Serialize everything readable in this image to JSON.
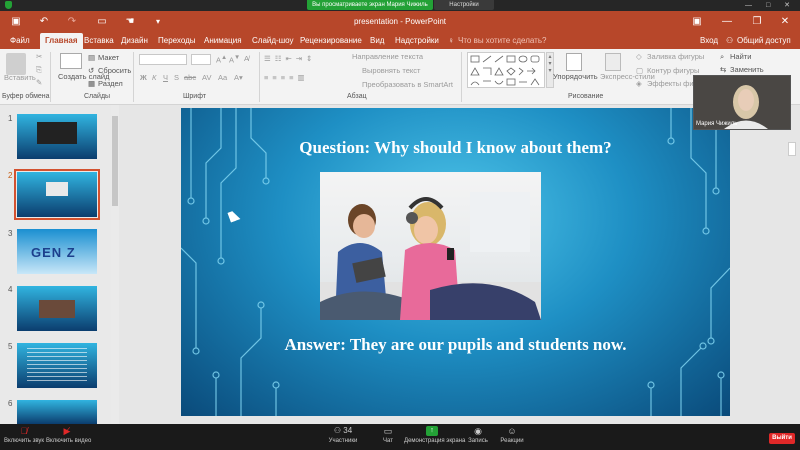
{
  "zoom": {
    "share_banner": "Вы просматриваете экран Мария Чижиль",
    "view_options": "Настройки просмотра ▾",
    "window_controls": "— □ ✕",
    "participant_name": "Мария Чижиль",
    "participant_count": "34",
    "bottom": {
      "mute_label": "Включить звук",
      "video_label": "Включить видео",
      "participants_label": "Участники",
      "chat_label": "Чат",
      "share_label": "Демонстрация экрана",
      "record_label": "Запись",
      "reactions_label": "Реакции",
      "leave_label": "Выйти"
    }
  },
  "ppt": {
    "title": "presentation - PowerPoint",
    "tabs": [
      "Файл",
      "Главная",
      "Вставка",
      "Дизайн",
      "Переходы",
      "Анимация",
      "Слайд-шоу",
      "Рецензирование",
      "Вид",
      "Надстройки"
    ],
    "tell_me": "Что вы хотите сделать?",
    "sign_in": "Вход",
    "share": "Общий доступ",
    "ribbon": {
      "paste": "Вставить",
      "clipboard_group": "Буфер обмена",
      "new_slide": "Создать слайд",
      "layout": "Макет",
      "reset": "Сбросить",
      "section": "Раздел",
      "slides_group": "Слайды",
      "font_group": "Шрифт",
      "text_direction": "Направление текста",
      "align_text": "Выровнять текст",
      "smartart": "Преобразовать в SmartArt",
      "paragraph_group": "Абзац",
      "arrange": "Упорядочить",
      "quick_styles": "Экспресс-стили",
      "shape_fill": "Заливка фигуры",
      "shape_outline": "Контур фигуры",
      "shape_effects": "Эффекты фигу",
      "drawing_group": "Рисование",
      "find": "Найти",
      "replace": "Заменить"
    },
    "thumbnails": [
      "1",
      "2",
      "3",
      "4",
      "5",
      "6"
    ],
    "selected_slide": "2",
    "thumb_texts": {
      "t3": "GEN Z"
    },
    "slide": {
      "question": "Question: Why should I know about them?",
      "answer": "Answer: They are our pupils and students now."
    }
  }
}
